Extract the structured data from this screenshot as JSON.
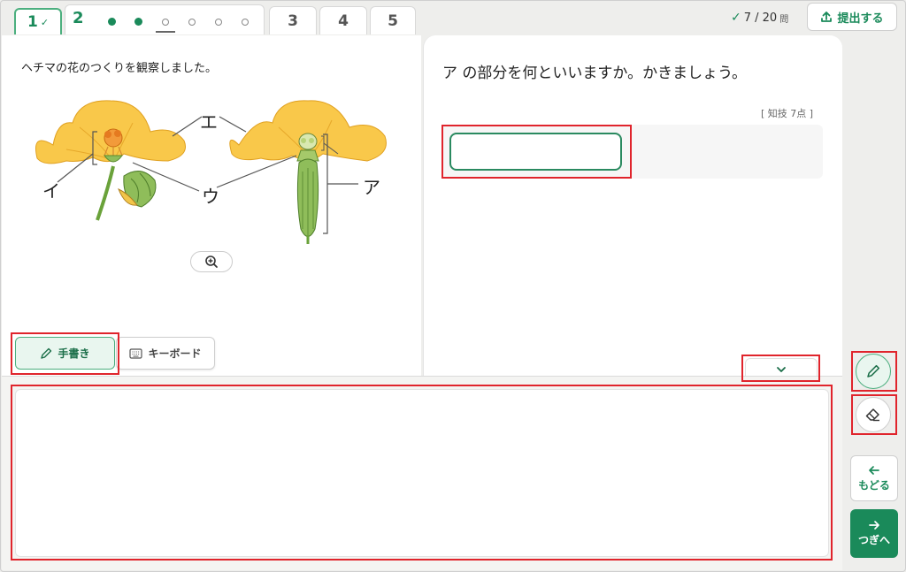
{
  "tabs": [
    {
      "label": "1",
      "checked": true,
      "state": "done"
    },
    {
      "label": "2",
      "state": "current"
    },
    {
      "label": "3"
    },
    {
      "label": "4"
    },
    {
      "label": "5"
    }
  ],
  "subquestion_dots": [
    "filled",
    "filled",
    "current",
    "open",
    "open",
    "open"
  ],
  "header": {
    "progress_count": "7 / 20",
    "progress_unit": "問",
    "submit_label": "提出する"
  },
  "problem": {
    "text": "ヘチマの花のつくりを観察しました。",
    "labels": {
      "a": "ア",
      "i": "イ",
      "u": "ウ",
      "e": "エ"
    }
  },
  "question": {
    "text": "ア の部分を何といいますか。かきましょう。",
    "score": "[ 知技 7点 ]",
    "answer": ""
  },
  "input_modes": {
    "handwriting": "手書き",
    "keyboard": "キーボード"
  },
  "nav": {
    "back_label": "もどる",
    "next_label": "つぎへ"
  },
  "colors": {
    "accent": "#1a8a5a",
    "highlight": "#e0242c",
    "petal": "#f9c84a"
  },
  "icons": {
    "pen": "pen-icon",
    "eraser": "eraser-icon",
    "zoom": "zoom-in-icon",
    "upload": "upload-icon",
    "keyboard": "keyboard-icon"
  }
}
